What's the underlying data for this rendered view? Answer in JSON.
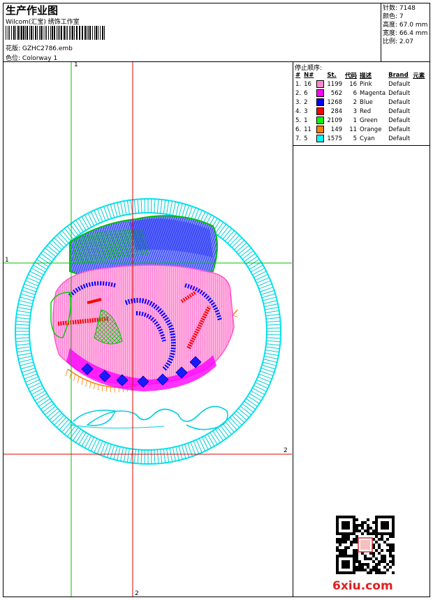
{
  "header": {
    "title": "生产作业图",
    "company": "Wilcom(汇宝) 绣饰工作室",
    "design_label": "花版:",
    "design_value": "GZHC2786.emb",
    "colorway_label": "色位:",
    "colorway_value": "Colorway 1"
  },
  "stats": {
    "stitches_label": "针数:",
    "stitches_value": "7148",
    "colors_label": "颜色:",
    "colors_value": "7",
    "height_label": "高度:",
    "height_value": "67.0 mm",
    "width_label": "宽度:",
    "width_value": "66.4 mm",
    "scale_label": "比例:",
    "scale_value": "2.07"
  },
  "stop_sequence": {
    "title": "停止顺序:",
    "columns": [
      "#",
      "N#",
      "St.",
      "代码",
      "描述",
      "Brand",
      "元素"
    ],
    "rows": [
      {
        "idx": "1.",
        "n": "16",
        "color": "#ff88cc",
        "st": "1199",
        "code": "16",
        "desc": "Pink",
        "brand": "Default"
      },
      {
        "idx": "2.",
        "n": "6",
        "color": "#ff00ff",
        "st": "562",
        "code": "6",
        "desc": "Magenta",
        "brand": "Default"
      },
      {
        "idx": "3.",
        "n": "2",
        "color": "#0000ff",
        "st": "1268",
        "code": "2",
        "desc": "Blue",
        "brand": "Default"
      },
      {
        "idx": "4.",
        "n": "3",
        "color": "#ff0000",
        "st": "284",
        "code": "3",
        "desc": "Red",
        "brand": "Default"
      },
      {
        "idx": "5.",
        "n": "1",
        "color": "#00ff00",
        "st": "2109",
        "code": "1",
        "desc": "Green",
        "brand": "Default"
      },
      {
        "idx": "6.",
        "n": "11",
        "color": "#ff8000",
        "st": "149",
        "code": "11",
        "desc": "Orange",
        "brand": "Default"
      },
      {
        "idx": "7.",
        "n": "5",
        "color": "#00ffff",
        "st": "1575",
        "code": "5",
        "desc": "Cyan",
        "brand": "Default"
      }
    ]
  },
  "guides": {
    "green_label": "1",
    "red_label": "2"
  },
  "watermark": {
    "logo_text": "6xiu.com"
  }
}
